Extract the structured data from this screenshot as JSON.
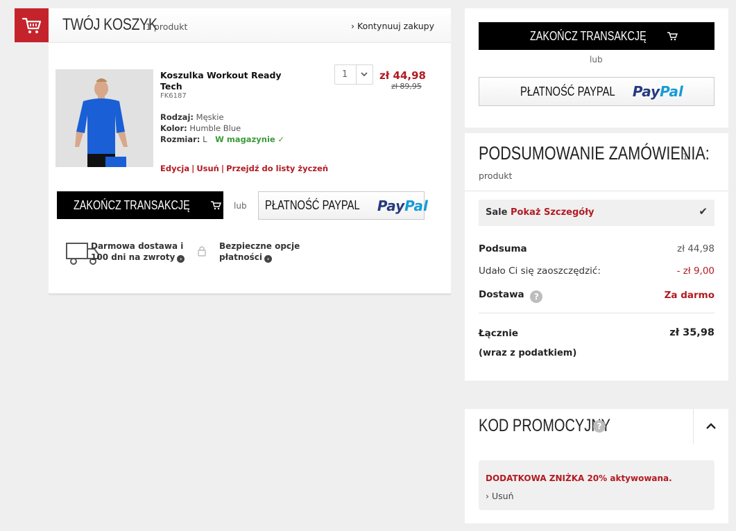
{
  "cart": {
    "title": "TWÓJ KOSZYK",
    "count": "1 produkt",
    "continue_link": "Kontynuuj zakupy",
    "product": {
      "name": "Koszulka Workout Ready Tech",
      "code": "FK6187",
      "type_label": "Rodzaj:",
      "type_value": "Męskie",
      "color_label": "Kolor:",
      "color_value": "Humble Blue",
      "size_label": "Rozmiar:",
      "size_value": "L",
      "stock": "W magazynie",
      "actions": [
        "Edycja",
        "Usuń",
        "Przejdź do listy życzeń"
      ],
      "quantity": "1",
      "price": "zł 44,98",
      "old_price": "zł 89,95"
    },
    "checkout_label": "ZAKOŃCZ TRANSAKCJĘ",
    "or": "lub",
    "paypal_label": "PŁATNOŚĆ PAYPAL",
    "paypal_logo_a": "Pay",
    "paypal_logo_b": "Pal",
    "features": [
      {
        "line1": "Darmowa dostawa i",
        "line2": "100 dni na zwroty"
      },
      {
        "line1": "Bezpieczne opcje",
        "line2": "płatności"
      }
    ]
  },
  "side": {
    "checkout_label": "ZAKOŃCZ TRANSAKCJĘ",
    "or": "lub",
    "paypal_label": "PŁATNOŚĆ PAYPAL"
  },
  "summary": {
    "title": "PODSUMOWANIE ZAMÓWIENIA:",
    "count_num": "1",
    "count_word": "produkt",
    "sale_label": "Sale",
    "sale_link": "Pokaż Szczegóły",
    "subtotal_label": "Podsuma",
    "subtotal_value": "zł 44,98",
    "saved_label": "Udało Ci się zaoszczędzić:",
    "saved_value": "- zł 9,00",
    "shipping_label": "Dostawa",
    "shipping_value": "Za darmo",
    "total_label": "Łącznie",
    "total_value": "zł 35,98",
    "tax_note": "(wraz z podatkiem)"
  },
  "promo": {
    "title": "KOD PROMOCYJNY",
    "message": "DODATKOWA ZNIŻKA 20% aktywowana.",
    "remove": "Usuń"
  },
  "colors": {
    "brand_red": "#c5232c",
    "price_red": "#b11b22",
    "in_stock_green": "#3a9b3a"
  }
}
